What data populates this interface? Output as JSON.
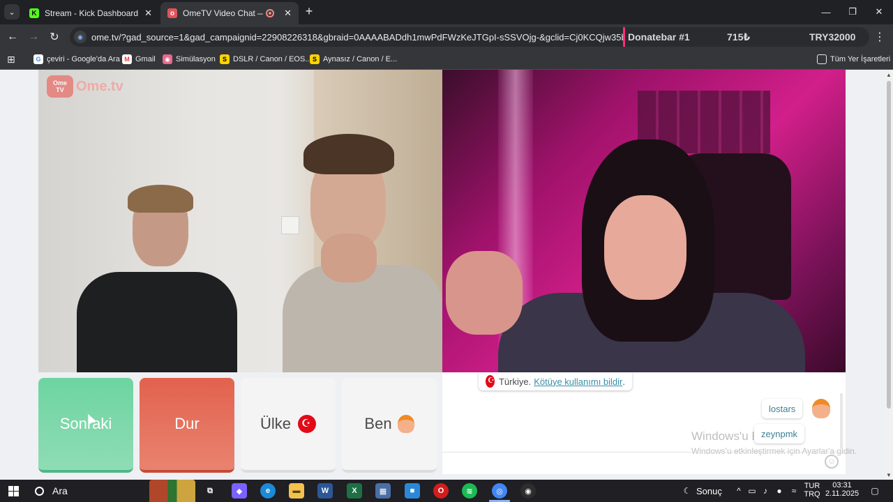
{
  "browser": {
    "tabs": [
      {
        "title": "Stream - Kick Dashboard",
        "favicon": "kick-icon",
        "favicon_glyph": "K",
        "active": false
      },
      {
        "title": "OmeTV Video Chat — Ome",
        "favicon": "ometv-icon",
        "favicon_glyph": "o",
        "active": true
      }
    ],
    "new_tab": "+",
    "window_controls": {
      "minimize": "—",
      "maximize": "❐",
      "close": "✕"
    },
    "tab_close": "✕",
    "tab_menu": "⌄",
    "nav": {
      "back": "←",
      "forward": "→",
      "reload": "↻"
    },
    "url": "ome.tv/?gad_source=1&gad_campaignid=22908226318&gbraid=0AAAABADdh1mwPdFWzKeJTGpI-sSSVOjg-&gclid=Cj0KCQjw35bIBhDqARIsAGjd-c",
    "menu": "⋮",
    "overlay": {
      "label": "Donatebar #1",
      "amount": "715₺",
      "total": "TRY32000"
    }
  },
  "bookmarks": [
    {
      "label": "çeviri - Google'da Ara",
      "icon": "google-icon",
      "glyph": "G"
    },
    {
      "label": "Gmail",
      "icon": "gmail-icon",
      "glyph": "M"
    },
    {
      "label": "Simülasyon",
      "icon": "simulation-icon",
      "glyph": "◉"
    },
    {
      "label": "DSLR / Canon / EOS...",
      "icon": "s-icon",
      "glyph": "S"
    },
    {
      "label": "Aynasız / Canon / E...",
      "icon": "s-icon",
      "glyph": "S"
    }
  ],
  "bookmarks_all": "Tüm Yer İşaretleri",
  "page": {
    "logo": {
      "badge_top": "Ome",
      "badge_bottom": "TV",
      "text": "Ome.tv"
    },
    "buttons": {
      "next": "Sonraki",
      "stop": "Dur",
      "country": "Ülke",
      "me": "Ben"
    },
    "chat": {
      "country": "Türkiye.",
      "report_link": "Kötüye kullanımı bildir",
      "report_suffix": ".",
      "messages": [
        "lostars",
        "zeynpmk"
      ],
      "smile": "☺"
    },
    "watermark": {
      "line1": "Windows'u Etkinleştir",
      "line2": "Windows'u etkinleştirmek için Ayarlar'a gidin."
    }
  },
  "taskbar": {
    "search": "Ara",
    "weather_label": "Sonuç",
    "lang_top": "TUR",
    "lang_bottom": "TRQ",
    "time": "03:31",
    "date": "2.11.2025",
    "apps": [
      {
        "name": "task-view-icon",
        "glyph": "⧉",
        "color": "#1f1f24"
      },
      {
        "name": "copilot-icon",
        "glyph": "◆",
        "color": "#7b61ff"
      },
      {
        "name": "edge-icon",
        "glyph": "e",
        "color": "#1b8ad8"
      },
      {
        "name": "file-explorer-icon",
        "glyph": "▬",
        "color": "#f2c14e"
      },
      {
        "name": "word-icon",
        "glyph": "W",
        "color": "#2b5797"
      },
      {
        "name": "excel-icon",
        "glyph": "X",
        "color": "#1d7044"
      },
      {
        "name": "calculator-icon",
        "glyph": "▦",
        "color": "#4a6fa5"
      },
      {
        "name": "store-icon",
        "glyph": "■",
        "color": "#2b88d8"
      },
      {
        "name": "opera-icon",
        "glyph": "O",
        "color": "#d41c1c"
      },
      {
        "name": "spotify-icon",
        "glyph": "≋",
        "color": "#1db954"
      },
      {
        "name": "chrome-icon",
        "glyph": "◎",
        "color": "#4285f4"
      },
      {
        "name": "obs-icon",
        "glyph": "◉",
        "color": "#2d2d2d"
      }
    ]
  }
}
